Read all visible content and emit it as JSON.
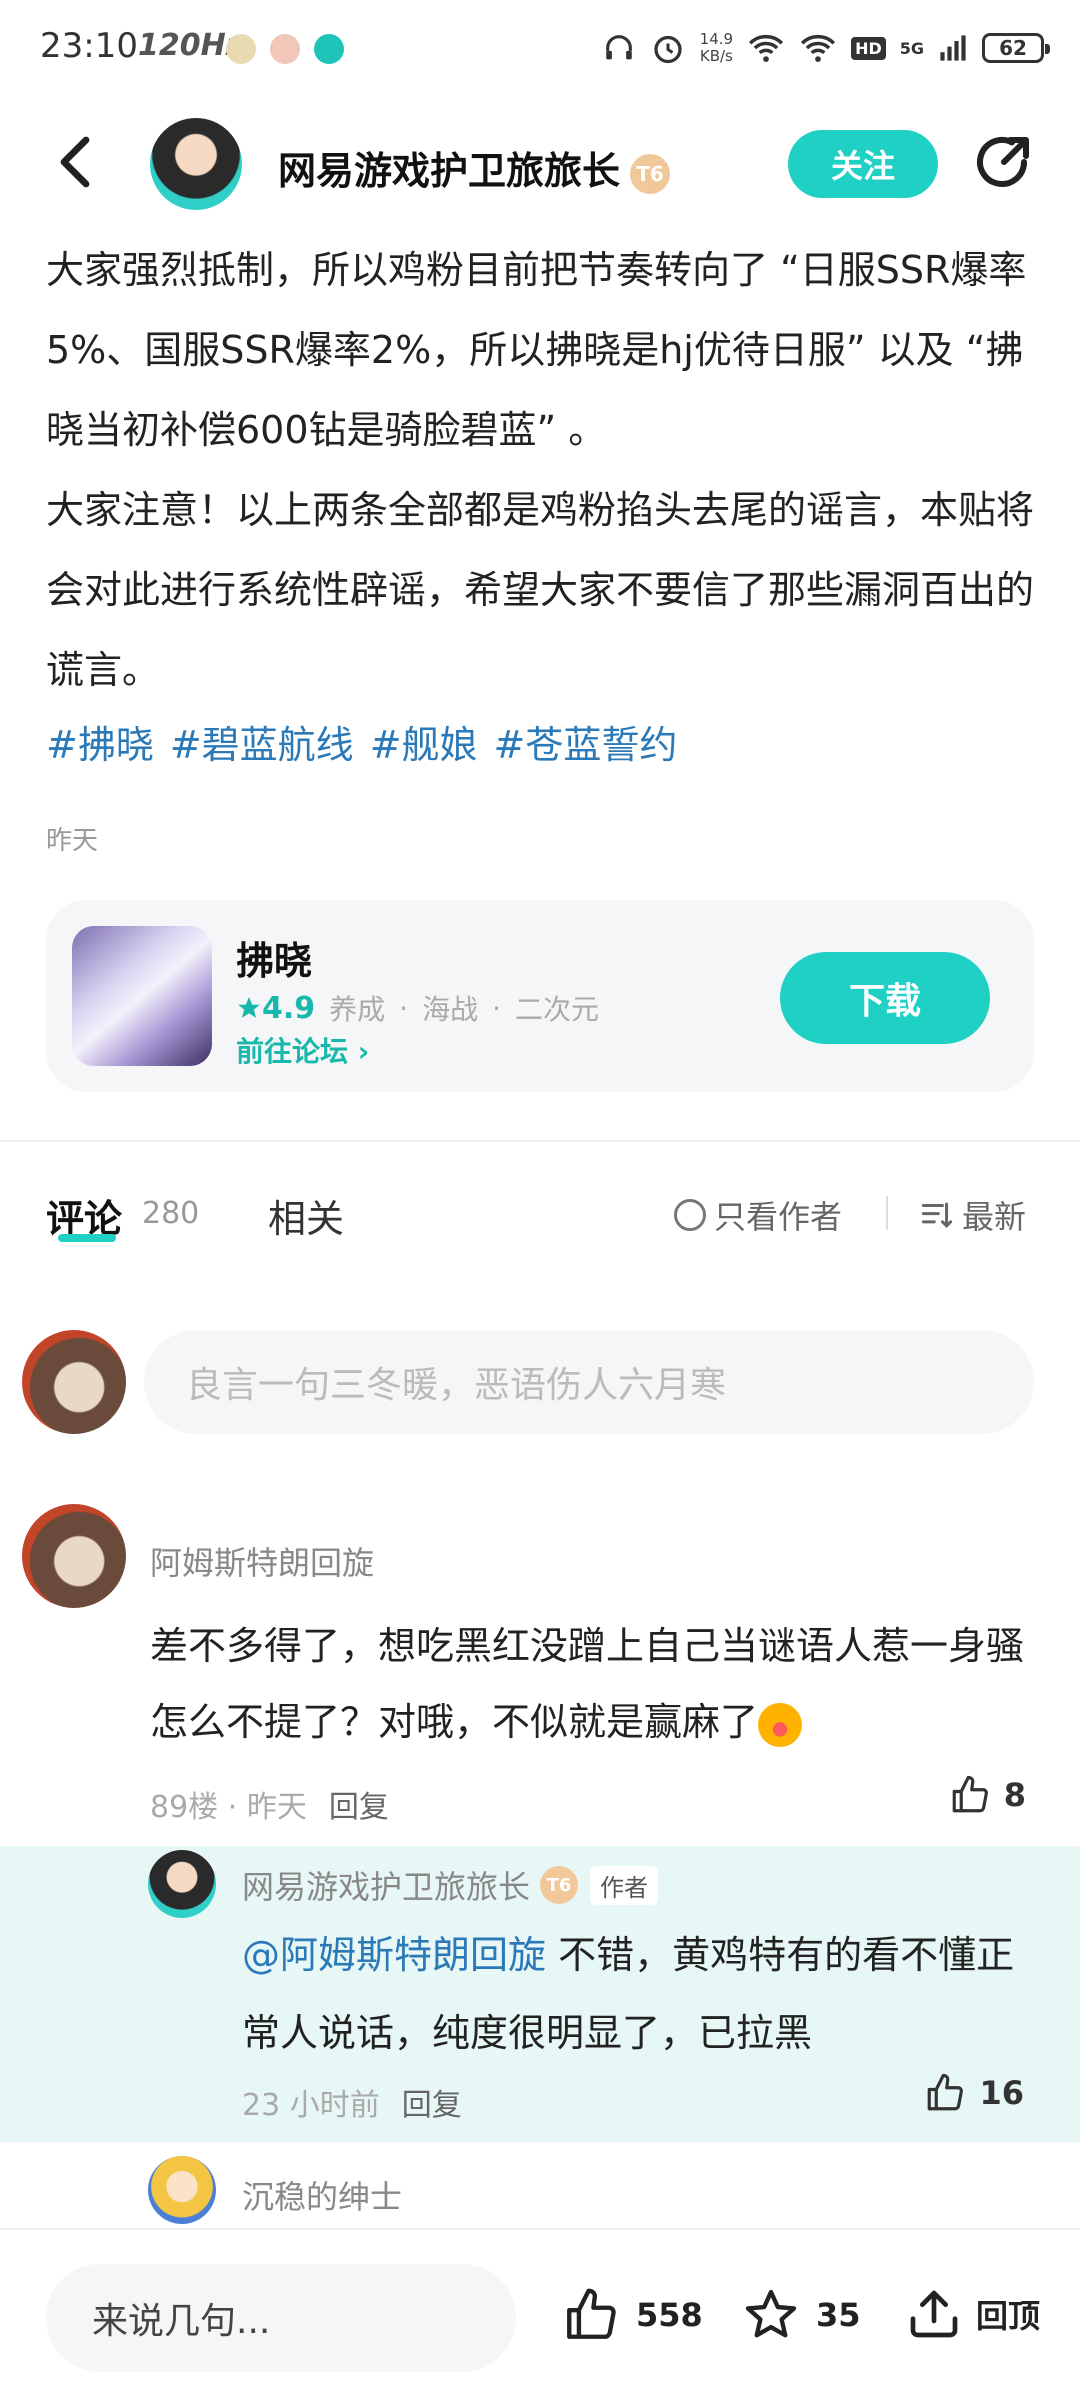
{
  "status_bar": {
    "time": "23:10",
    "refresh": "120Hz",
    "net_speed_value": "14.9",
    "net_speed_unit": "KB/s",
    "hd": "HD",
    "network": "5G",
    "battery": "62"
  },
  "header": {
    "author_name": "网易游戏护卫旅旅长",
    "level_badge": "T6",
    "follow_label": "关注"
  },
  "article": {
    "paragraphs": [
      "大家强烈抵制，所以鸡粉目前把节奏转向了 “日服SSR爆率5%、国服SSR爆率2%，所以拂晓是hj优待日服” 以及 “拂晓当初补偿600钻是骑脸碧蓝” 。",
      "大家注意！以上两条全部都是鸡粉掐头去尾的谣言，本贴将会对此进行系统性辟谣，希望大家不要信了那些漏洞百出的谎言。"
    ],
    "tags": [
      "#拂晓",
      "#碧蓝航线",
      "#舰娘",
      "#苍蓝誓约"
    ],
    "time": "昨天"
  },
  "app_card": {
    "name": "拂晓",
    "rating": "4.9",
    "genres": [
      "养成",
      "海战",
      "二次元"
    ],
    "forum_link": "前往论坛 ›",
    "download_label": "下载"
  },
  "tabs": {
    "comments_label": "评论",
    "comments_count": "280",
    "related_label": "相关",
    "author_only_label": "只看作者",
    "sort_label": "最新"
  },
  "comment_input": {
    "placeholder": "良言一句三冬暖，恶语伤人六月寒"
  },
  "comments": [
    {
      "user": "阿姆斯特朗回旋",
      "text": "差不多得了，想吃黑红没蹭上自己当谜语人惹一身骚怎么不提了？对哦，不似就是赢麻了",
      "floor": "89楼",
      "dot": "·",
      "time": "昨天",
      "reply_label": "回复",
      "likes": "8",
      "reply": {
        "user": "网易游戏护卫旅旅长",
        "badge": "T6",
        "author_tag": "作者",
        "mention": "@阿姆斯特朗回旋",
        "text": " 不错，黄鸡特有的看不懂正常人说话，纯度很明显了，已拉黑",
        "time": "23 小时前",
        "reply_label": "回复",
        "likes": "16"
      }
    },
    {
      "user": "沉稳的绅士"
    }
  ],
  "bottom_bar": {
    "input_placeholder": "来说几句...",
    "likes": "558",
    "favorites": "35",
    "back_to_top": "回顶"
  },
  "colors": {
    "accent": "#1fd1c4",
    "tag_blue": "#2c79b8",
    "reply_bg": "#e6f7f6"
  }
}
